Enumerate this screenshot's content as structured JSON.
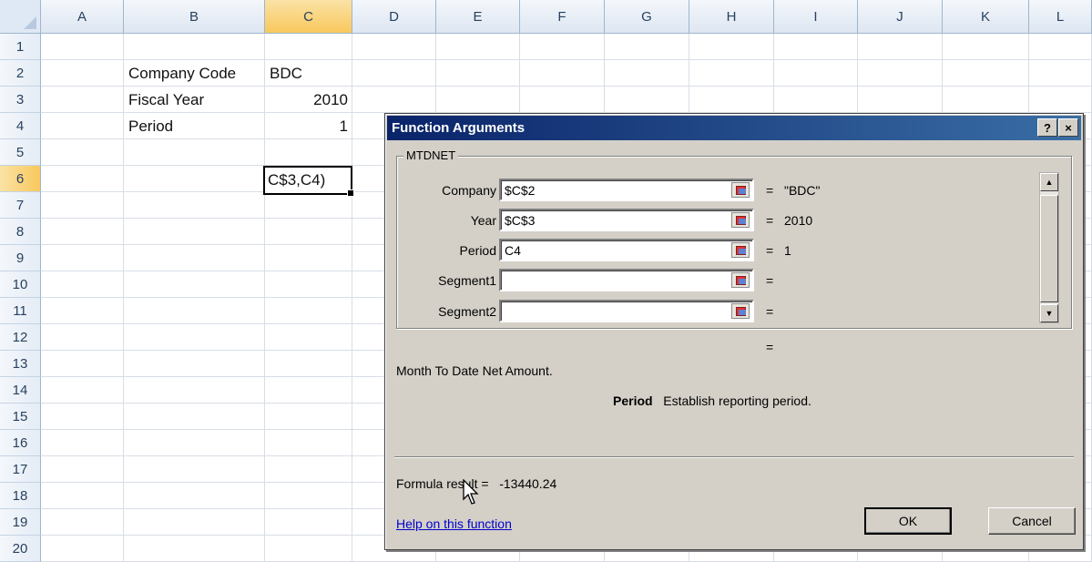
{
  "spreadsheet": {
    "corner_icon": "select-all-triangle",
    "columns": [
      {
        "label": "A",
        "selected": false
      },
      {
        "label": "B",
        "selected": false
      },
      {
        "label": "C",
        "selected": true
      },
      {
        "label": "D",
        "selected": false
      },
      {
        "label": "E",
        "selected": false
      },
      {
        "label": "F",
        "selected": false
      },
      {
        "label": "G",
        "selected": false
      },
      {
        "label": "H",
        "selected": false
      },
      {
        "label": "I",
        "selected": false
      },
      {
        "label": "J",
        "selected": false
      },
      {
        "label": "K",
        "selected": false
      },
      {
        "label": "L",
        "selected": false
      }
    ],
    "rows": [
      "1",
      "2",
      "3",
      "4",
      "5",
      "6",
      "7",
      "8",
      "9",
      "10",
      "11",
      "12",
      "13",
      "14",
      "15",
      "16",
      "17",
      "18",
      "19",
      "20"
    ],
    "selected_row": "6",
    "cells": {
      "B2": "Company Code",
      "C2": "BDC",
      "B3": "Fiscal Year",
      "C3": "2010",
      "B4": "Period",
      "C4": "1",
      "C6": "C$3,C4)"
    }
  },
  "dialog": {
    "title": "Function Arguments",
    "help_button": "?",
    "close_button": "×",
    "function_name": "MTDNET",
    "arguments": [
      {
        "label": "Company",
        "value": "$C$2",
        "eq": "=",
        "result": "\"BDC\""
      },
      {
        "label": "Year",
        "value": "$C$3",
        "eq": "=",
        "result": "2010"
      },
      {
        "label": "Period",
        "value": "C4",
        "eq": "=",
        "result": "1"
      },
      {
        "label": "Segment1",
        "value": "",
        "eq": "=",
        "result": ""
      },
      {
        "label": "Segment2",
        "value": "",
        "eq": "=",
        "result": ""
      }
    ],
    "overall_eq": "=",
    "description": "Month To Date Net Amount.",
    "param_name": "Period",
    "param_description": "Establish reporting period.",
    "formula_result_label": "Formula result =",
    "formula_result_value": "-13440.24",
    "help_link": "Help on this function",
    "ok_label": "OK",
    "cancel_label": "Cancel",
    "scroll_up_icon": "▲",
    "scroll_down_icon": "▼"
  }
}
